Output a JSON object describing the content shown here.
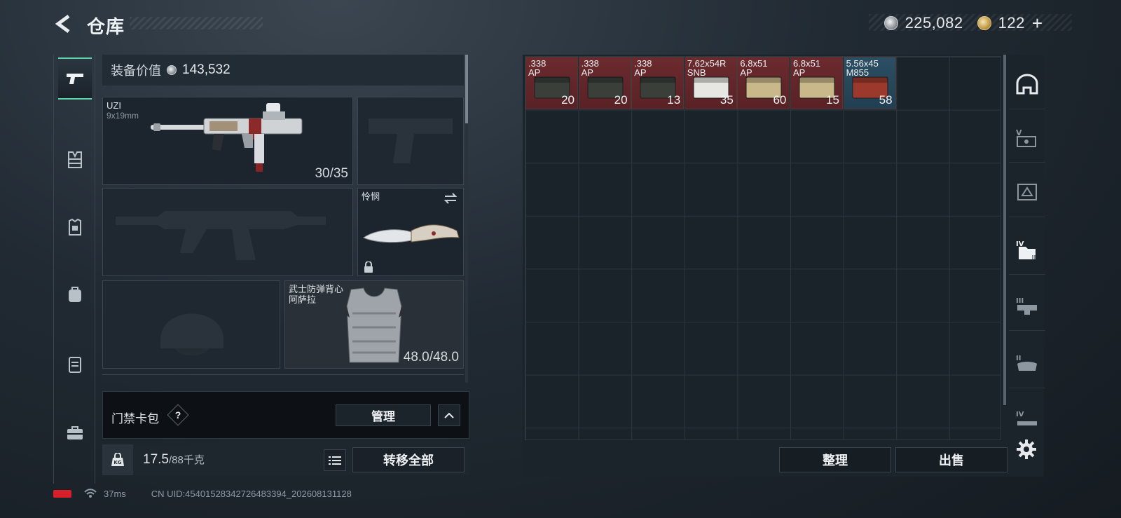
{
  "header": {
    "title": "仓库",
    "currencies": [
      {
        "icon": "silver-coin-icon",
        "value": "225,082"
      },
      {
        "icon": "gold-coin-icon",
        "value": "122"
      }
    ],
    "plus_label": "+"
  },
  "left_rail": {
    "tabs": [
      {
        "name": "weapon",
        "icon": "pistol-icon",
        "active": true
      },
      {
        "name": "vest",
        "icon": "chest-rig-icon",
        "active": false
      },
      {
        "name": "armor",
        "icon": "body-armor-icon",
        "active": false
      },
      {
        "name": "backpack",
        "icon": "backpack-icon",
        "active": false
      },
      {
        "name": "container",
        "icon": "container-icon",
        "active": false
      },
      {
        "name": "case",
        "icon": "briefcase-icon",
        "active": false
      }
    ]
  },
  "equipment": {
    "value_label": "装备价值",
    "value": "143,532",
    "primary_slot": {
      "name": "UZI",
      "caliber": "9x19mm",
      "ammo": "30/35"
    },
    "melee_slot": {
      "name": "怜悯"
    },
    "armor_slot": {
      "name_line1": "武士防弹背心",
      "name_line2": "阿萨拉",
      "durability": "48.0/48.0"
    }
  },
  "keycard": {
    "label": "门禁卡包",
    "help": "?",
    "manage_label": "管理"
  },
  "weight": {
    "current": "17.5",
    "max": "/88千克",
    "transfer_label": "转移全部"
  },
  "status": {
    "ping": "37ms",
    "uid": "CN UID:4540152834272648339​4_202608131128"
  },
  "storage": {
    "items": [
      {
        "name": ".338\nAP",
        "qty": "20",
        "color": "red"
      },
      {
        "name": ".338\nAP",
        "qty": "20",
        "color": "red"
      },
      {
        "name": ".338\nAP",
        "qty": "13",
        "color": "red"
      },
      {
        "name": "7.62x54R\nSNB",
        "qty": "35",
        "color": "red"
      },
      {
        "name": "6.8x51\nAP",
        "qty": "60",
        "color": "red"
      },
      {
        "name": "6.8x51\nAP",
        "qty": "15",
        "color": "red"
      },
      {
        "name": "5.56x45\nM855",
        "qty": "58",
        "color": "blue"
      }
    ],
    "sort_label": "整理",
    "sell_label": "出售"
  },
  "right_rail": {
    "tabs": [
      {
        "label": "",
        "icon": "stash-arch-icon"
      },
      {
        "label": "V",
        "icon": "tier-5-storage-icon"
      },
      {
        "label": "",
        "icon": "tier-4-storage-icon"
      },
      {
        "label": "IV",
        "icon": "tier-4-folder-icon"
      },
      {
        "label": "III",
        "icon": "tier-3-storage-icon"
      },
      {
        "label": "II",
        "icon": "tier-2-storage-icon"
      },
      {
        "label": "IV",
        "icon": "tier-4-extra-icon"
      }
    ]
  },
  "colors": {
    "accent": "#5ad7a7",
    "rare_red": "#6b2a2e",
    "rare_blue": "#2c4f63"
  }
}
